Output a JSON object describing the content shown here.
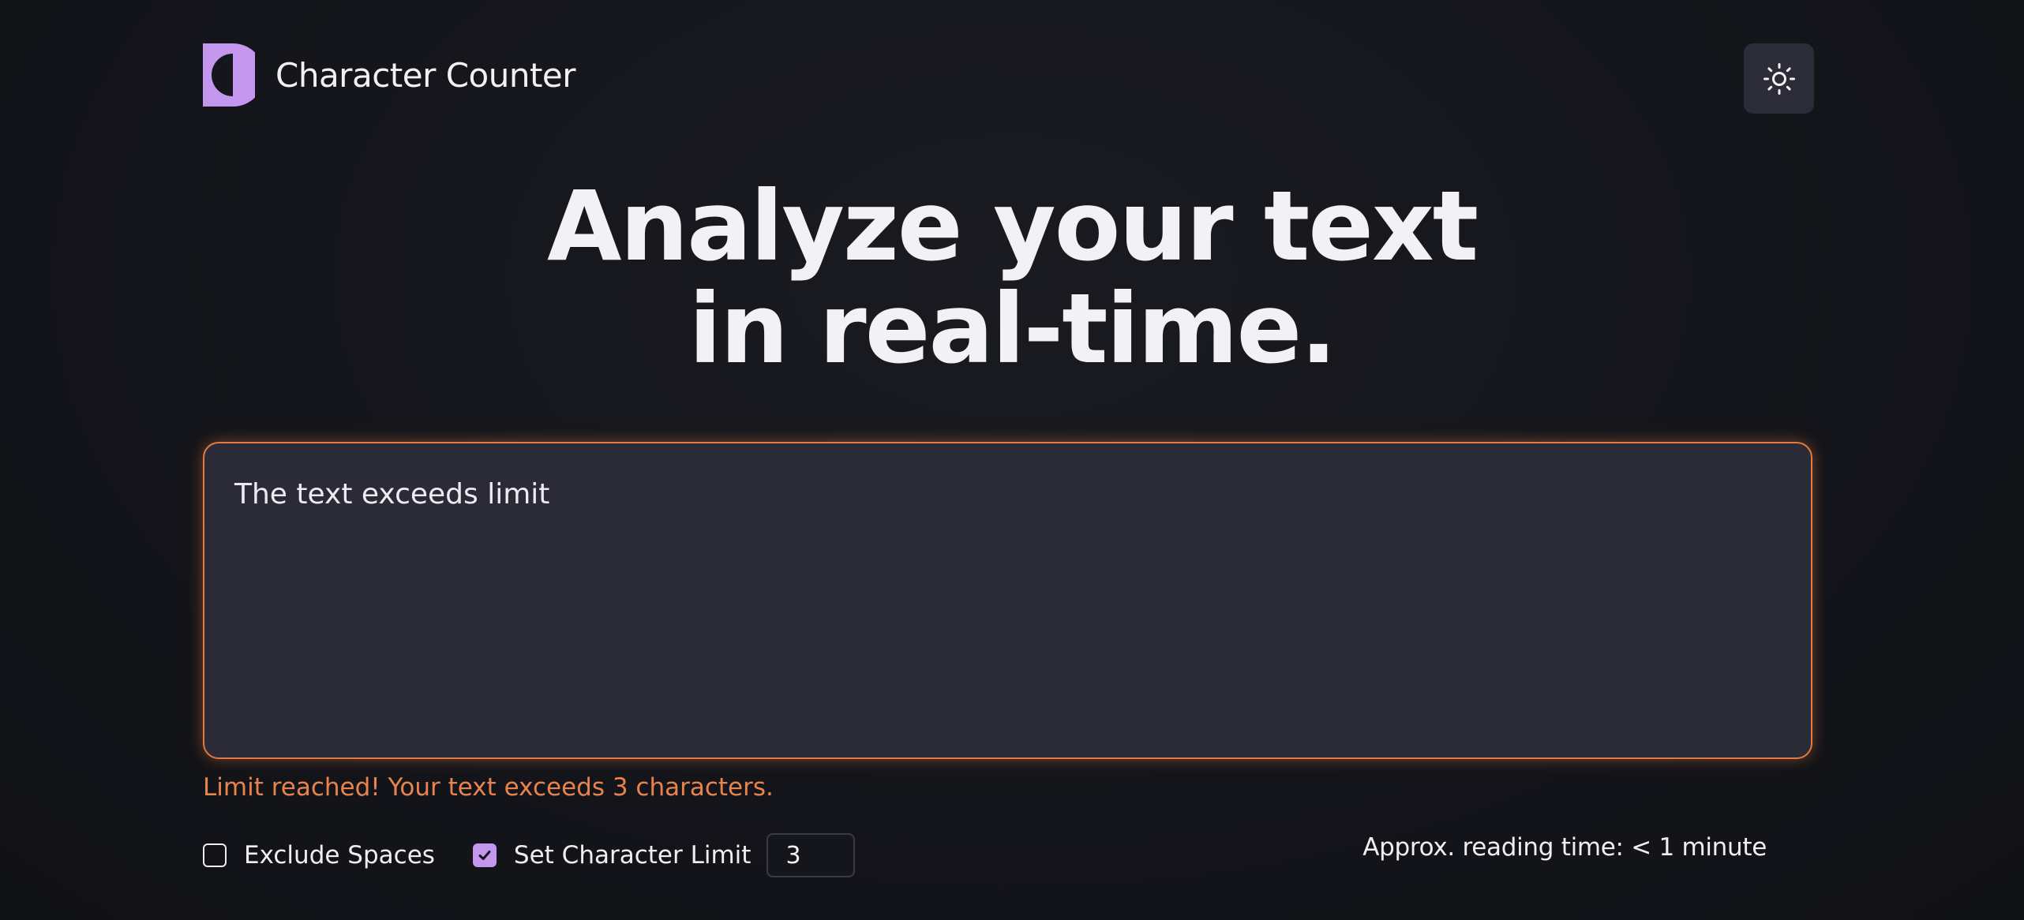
{
  "header": {
    "app_title": "Character Counter",
    "logo_icon": "logo-icon",
    "theme_toggle_icon": "sun-icon"
  },
  "hero": {
    "line1": "Analyze your text",
    "line2": "in real-time."
  },
  "editor": {
    "value": "The text exceeds limit",
    "border_color": "#e2793f"
  },
  "warning": {
    "text": "Limit reached! Your text exceeds 3 characters."
  },
  "options": {
    "exclude_spaces_label": "Exclude Spaces",
    "exclude_spaces_checked": false,
    "set_limit_label": "Set Character Limit",
    "set_limit_checked": true,
    "limit_value": "3"
  },
  "reading_time": {
    "text": "Approx. reading time: < 1 minute"
  },
  "colors": {
    "accent": "#c596ee",
    "warning": "#e9834e",
    "background": "#15161b",
    "panel": "#2a2b37"
  }
}
